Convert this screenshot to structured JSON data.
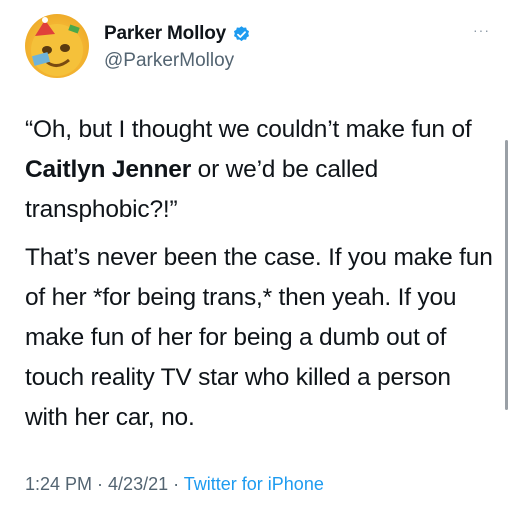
{
  "author": {
    "name": "Parker Molloy",
    "handle": "@ParkerMolloy",
    "verified": true
  },
  "tweet": {
    "line1_prefix": "“Oh, but I thought we couldn’t make fun of ",
    "line1_bold": "Caitlyn Jenner",
    "line1_suffix": " or we’d be called transphobic?!”",
    "paragraph2": "That’s never been the case. If you make fun of her *for being trans,* then yeah. If you make fun of her for being a dumb out of touch reality TV star who killed a person with her car, no."
  },
  "meta": {
    "time": "1:24 PM",
    "separator1": " · ",
    "date": "4/23/21",
    "separator2": " · ",
    "source": "Twitter for iPhone"
  },
  "more_label": "···",
  "colors": {
    "accent": "#1d9bf0",
    "secondary_text": "#536471",
    "text": "#0f1419"
  }
}
